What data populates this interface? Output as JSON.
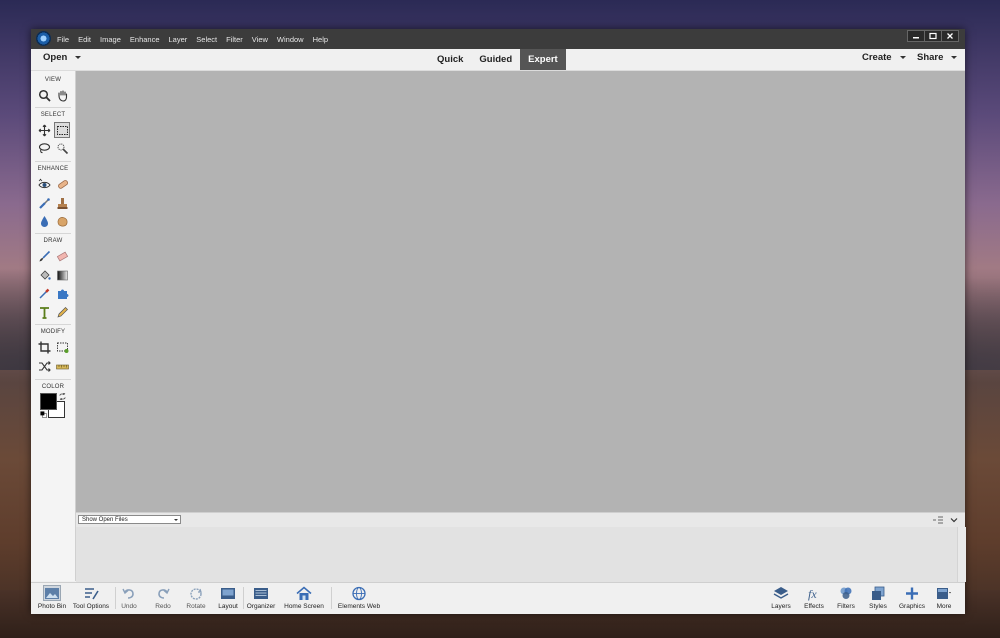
{
  "menu": [
    "File",
    "Edit",
    "Image",
    "Enhance",
    "Layer",
    "Select",
    "Filter",
    "View",
    "Window",
    "Help"
  ],
  "topbar": {
    "open_label": "Open",
    "modes": [
      "Quick",
      "Guided",
      "Expert"
    ],
    "active_mode": "Expert",
    "create_label": "Create",
    "share_label": "Share"
  },
  "toolbox": {
    "sections": {
      "view": "VIEW",
      "select": "SELECT",
      "enhance": "ENHANCE",
      "draw": "DRAW",
      "modify": "MODIFY",
      "color": "COLOR"
    },
    "colors": {
      "foreground": "#000000",
      "background": "#ffffff"
    }
  },
  "photo_bin": {
    "dropdown_value": "Show Open Files"
  },
  "taskbar": {
    "left": [
      "Photo Bin",
      "Tool Options",
      "Undo",
      "Redo",
      "Rotate",
      "Layout",
      "Organizer",
      "Home Screen",
      "Elements Web"
    ],
    "right": [
      "Layers",
      "Effects",
      "Filters",
      "Styles",
      "Graphics",
      "More"
    ]
  }
}
